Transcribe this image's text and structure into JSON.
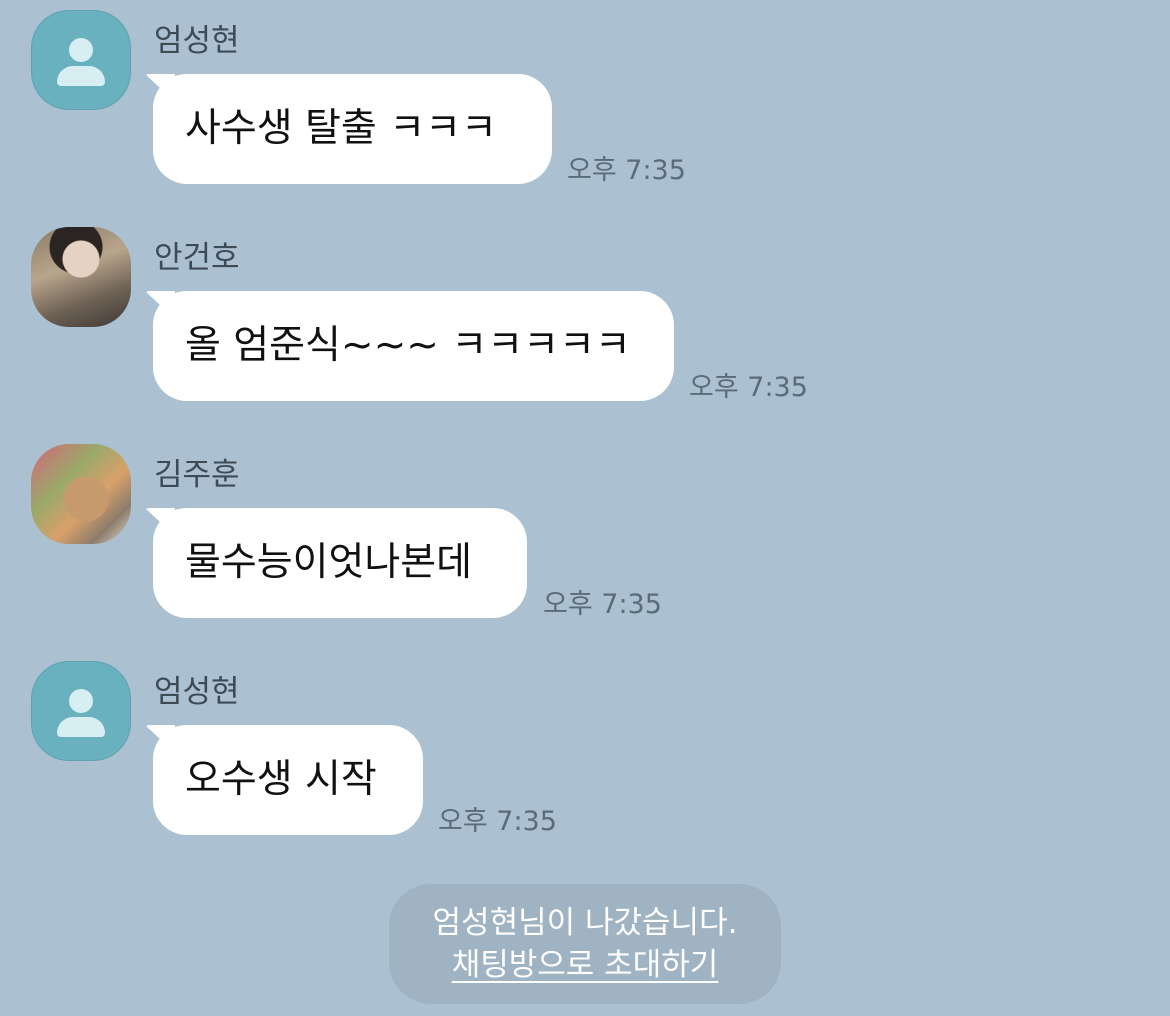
{
  "messages": [
    {
      "sender": "엄성현",
      "avatar": "default-profile-icon",
      "text": "사수생 탈출 ㅋㅋㅋ",
      "time": "오후 7:35"
    },
    {
      "sender": "안건호",
      "avatar": "profile-photo",
      "text": "올 엄준식~~~ ㅋㅋㅋㅋㅋ",
      "time": "오후 7:35"
    },
    {
      "sender": "김주훈",
      "avatar": "profile-photo",
      "text": "물수능이엇나본데",
      "time": "오후 7:35"
    },
    {
      "sender": "엄성현",
      "avatar": "default-profile-icon",
      "text": "오수생 시작",
      "time": "오후 7:35"
    }
  ],
  "notice": {
    "text": "엄성현님이 나갔습니다.",
    "invite_link": "채팅방으로 초대하기"
  },
  "colors": {
    "background": "#abc1d1",
    "bubble": "#ffffff",
    "default_avatar": "#6ab1bf",
    "notice_bg": "#9fb3c3"
  }
}
